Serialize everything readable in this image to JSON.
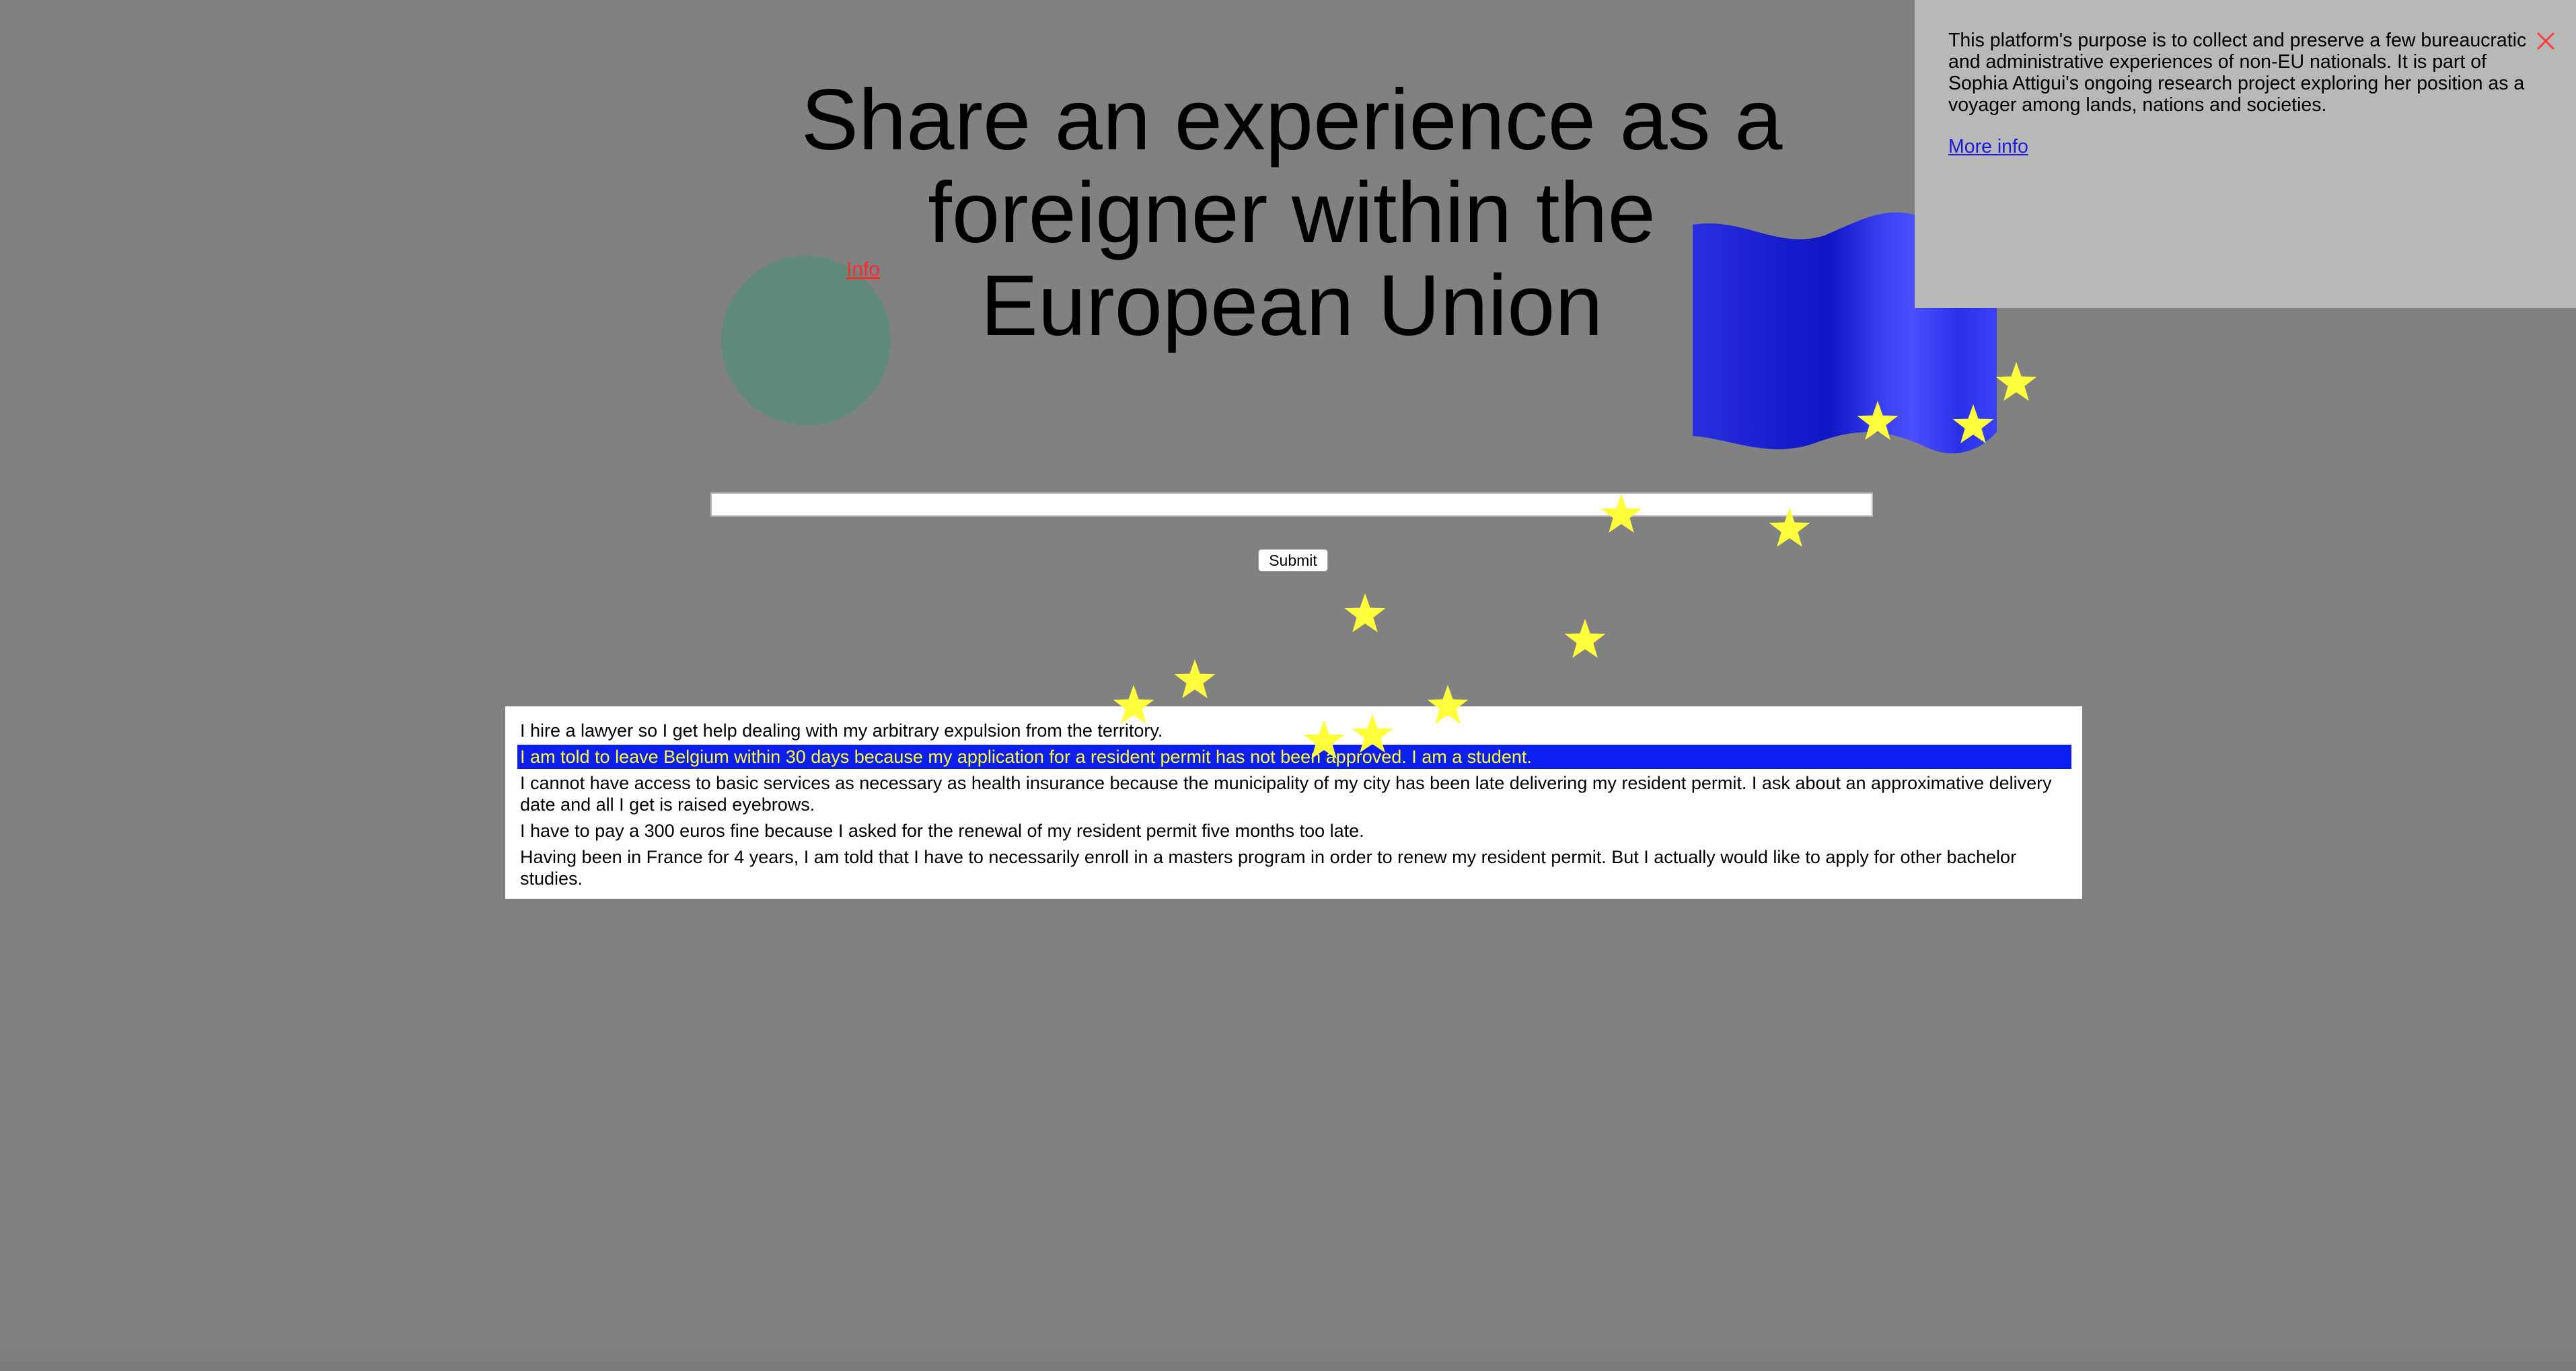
{
  "header": {
    "title": "Share an experience as a foreigner within the European Union",
    "info_link": "Info"
  },
  "form": {
    "input_value": "",
    "submit_label": "Submit"
  },
  "experiences": [
    {
      "text": "I hire a lawyer so I get help dealing with my arbitrary expulsion from the territory.",
      "highlighted": false
    },
    {
      "text": "I am told to leave Belgium within 30 days because my application for a resident permit has not been approved. I am a student.",
      "highlighted": true
    },
    {
      "text": "I cannot have access to basic services as necessary as health insurance because the municipality of my city has been late delivering my resident permit. I ask about an approximative delivery date and all I get is raised eyebrows.",
      "highlighted": false
    },
    {
      "text": "I have to pay a 300 euros fine because I asked for the renewal of my resident permit five months too late.",
      "highlighted": false
    },
    {
      "text": "Having been in France for 4 years, I am told that I have to necessarily enroll in a masters program in order to renew my resident permit. But I actually would like to apply for other bachelor studies.",
      "highlighted": false
    }
  ],
  "info_panel": {
    "text": "This platform's purpose is to collect and preserve a few bureaucratic and administrative experiences of non-EU nationals. It is part of Sophia Attigui's ongoing research project exploring her position as a voyager among lands, nations and societies.",
    "more_info_label": "More info",
    "close_icon": "close-icon"
  },
  "colors": {
    "background": "#818181",
    "highlight_bg": "#0d1ef2",
    "highlight_text": "#ffff2e",
    "star": "#ffff3c",
    "flag": "#2b33e8",
    "info_link": "#ff2a2a",
    "close_icon": "#ff3b3b",
    "circle": "#5f8a7c"
  }
}
